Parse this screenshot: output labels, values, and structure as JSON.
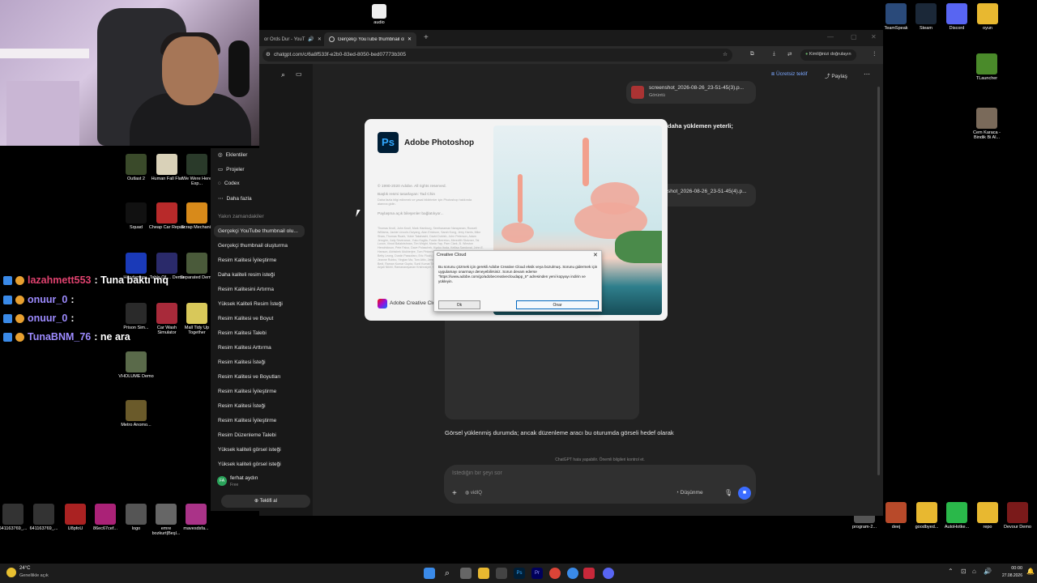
{
  "top_icon": {
    "label": "audio"
  },
  "browser": {
    "tabs": [
      {
        "label": "or Ords Dur - YouT"
      },
      {
        "label": "Gerçekçi YouTube thumbnail ol"
      }
    ],
    "url": "chatgpt.com/c/6a8f533f-e2b0-83ed-8050-bed07773b305",
    "verify_label": "Kimliğinizi doğrulayın"
  },
  "chatgpt": {
    "free_offer": "Ücretsiz teklif",
    "share": "Paylaş",
    "side_nav": [
      "Eklentiler",
      "Projeler",
      "Codex",
      "Daha fazla"
    ],
    "recent_title": "Yakın zamandakiler",
    "recent": [
      "Gerçekçi YouTube thumbnail olu...",
      "Gerçekçi thumbnail oluşturma",
      "Resim Kalitesi İyileştirme",
      "Daha kaliteli resim isteği",
      "Resim Kalitesini Artırma",
      "Yüksek Kaliteli Resim İsteği",
      "Resim Kalitesi ve Boyut",
      "Resim Kalitesi Talebi",
      "Resim Kalitesi Arttırma",
      "Resim Kalitesi İsteği",
      "Resim Kalitesi ve Boyutları",
      "Resim Kalitesi İyileştirme",
      "Resim Kalitesi İsteği",
      "Resim Kalitesi İyileştirme",
      "Resim Düzenleme Talebi",
      "Yüksek kaliteli görsel isteği",
      "Yüksek kaliteli görsel isteği"
    ],
    "user": {
      "name": "ferhat aydın",
      "plan": "Free",
      "initials": "FA"
    },
    "upgrade": "Teklifi al",
    "attachment1": {
      "name": "screenshot_2026-08-26_23-51-45(3).p...",
      "type": "Görüntü"
    },
    "attachment2": {
      "name": "shot_2026-08-26_23-51-45(4).p..."
    },
    "user_msg": "daha yüklemen yeterli;",
    "assistant_msg": "Görsel yüklenmiş durumda; ancak düzenleme aracı bu oturumda görseli hedef olarak",
    "disclaimer": "ChatGPT hata yapabilir. Önemli bilgileri kontrol et.",
    "composer_placeholder": "İstediğin bir şeyi sor",
    "composer_tool": "vidIQ",
    "think_label": "Düşünme"
  },
  "photoshop": {
    "app_name": "Adobe Photoshop",
    "logo_text": "Ps",
    "copyright": "© 1990-2020 Adobe. All rights reserved.",
    "artist": "Başlık resmi tasarlayan: Tad Chin",
    "legal": "Daha fazla bilgi edinmek ve yasal bildirimler için Photoshop hakkında alanına gidin.",
    "loading": "Paylaşma açık bileşenler bağlatılıyor...",
    "credits": "Thomas Knoll, John Knoll, Mark Hamburg, Seetharaman Narayanan, Russell Williams, Jackie Lincoln-Owyang, Alan Erickson, Sarah Kong, Jerry Harris, Mike Shaw, Thomas Ruark, Yukie Takahashi, David Dobish, John Peterson, Adam Jerugim, Judy Severance, Yuko Kagita, Foster Brereton, Meredith Stotzner, Tai Luxon, Vinod Balakrishnan, Tim Wright, Maria Yap, Pam Clark, B. Winston Hendrickson, Pete Falco, Dave Polaschek, Kyoko Itoda, Kellisa Sandoval, John E. Hanson, Abhishek Mukherjee, Tom Pinkerton, Michael Orts, Seth Shaw, Joel Baer, Betty Leong, Dustin Passofaro, Eric Floch, Ivy Mak, Blake Marlow, Michael Clifton, Jeanne Rubbo, Yinglan Ma, Tom Attix, Jenn Seelo, Ruchi Sood, Yilin Wang, Ajay Bedi, Raman Kumar Gupta, Sunil Kumar Tandon, Rick Mandia, Ashish Chandra, Anjali Nikhil, Ramanarayanan Krishnaiyer, Sohrab Amirghodsi, Louise Huang",
    "cc_footer": "Adobe Creative Cloud"
  },
  "creative_cloud_dialog": {
    "title": "Creative Cloud",
    "message": "Bu sorunu çözmek için gerekli Adobe Creative Cloud eksik veya bozulmuş. Sorunu gidermek için uygulamayı onarmayı deneyebilirsiniz. Sorun devam ederse \"https://www.adobe.com/go/adobecreativecloudapp_tr\" adresinden yeni kopyayı indirin ve yükleyin.",
    "button_left": "Ok",
    "button_right": "Onar"
  },
  "stream_chat": [
    {
      "user": "lazahmett553",
      "text": ": Tuna baktı mq",
      "color": "#e0426f"
    },
    {
      "user": "onuur_0",
      "text": ":",
      "color": "#9d8bff"
    },
    {
      "user": "onuur_0",
      "text": ":",
      "color": "#9d8bff"
    },
    {
      "user": "TunaBNM_76",
      "text": ": ne ara",
      "color": "#9d8bff"
    }
  ],
  "desktop_left": [
    {
      "label": "Outlast 2",
      "color": "#3a4a2a"
    },
    {
      "label": "Human Fall Flat",
      "color": "#d9d1b8"
    },
    {
      "label": "We Were Here Exp...",
      "color": "#2a3a2a"
    },
    {
      "label": "Squad",
      "color": "#111111"
    },
    {
      "label": "Cheap Car Repair",
      "color": "#b82a2a"
    },
    {
      "label": "Scrap Mechanic",
      "color": "#d88a1a"
    },
    {
      "label": "Handyman...",
      "color": "#1a3ab8"
    },
    {
      "label": "Table Of ... Demo",
      "color": "#2a2a6a"
    },
    {
      "label": "Separated Demo",
      "color": "#4a5a3a"
    },
    {
      "label": "Prison Sim...",
      "color": "#2a2a2a"
    },
    {
      "label": "Car Wash Simulator",
      "color": "#a82a3a"
    },
    {
      "label": "Mall Tidy Up Together",
      "color": "#d8c85a"
    },
    {
      "label": "VHOLUME Demo",
      "color": "#5a6a4a"
    },
    {
      "label": "Metro Anomo...",
      "color": "#6a5a2a"
    }
  ],
  "desktop_bottom": [
    {
      "label": "641163769_...",
      "color": "#333333"
    },
    {
      "label": "641163769_...",
      "color": "#333333"
    },
    {
      "label": "U8pfoU",
      "color": "#aa2222"
    },
    {
      "label": "86ec67cef...",
      "color": "#aa2277"
    },
    {
      "label": "logo",
      "color": "#555555"
    },
    {
      "label": "emre bozkurt|Beşl...",
      "color": "#666666"
    },
    {
      "label": "mavesdsfa...",
      "color": "#aa3388"
    }
  ],
  "desktop_right_top": [
    {
      "label": "TeamSpeak",
      "color": "#2a4a7a"
    },
    {
      "label": "Steam",
      "color": "#1b2838"
    },
    {
      "label": "Discord",
      "color": "#5865f2"
    },
    {
      "label": "oyun",
      "color": "#e8b830"
    }
  ],
  "desktop_right_mid": [
    {
      "label": "TLauncher",
      "color": "#4a8a2a"
    },
    {
      "label": "Cem Karaca - Bindik Bi Al...",
      "color": "#7a6a5a"
    }
  ],
  "desktop_right_bottom": [
    {
      "label": "program-2...",
      "color": "#555555"
    },
    {
      "label": "deej",
      "color": "#b84a2a"
    },
    {
      "label": "goodbyed...",
      "color": "#e8b830"
    },
    {
      "label": "AutoHotke...",
      "color": "#2ab84a"
    },
    {
      "label": "repo",
      "color": "#e8b830"
    },
    {
      "label": "Devour Demo",
      "color": "#7a1a1a"
    }
  ],
  "taskbar": {
    "weather_temp": "24°C",
    "weather_desc": "Genellikle açık",
    "time": "00:00",
    "date": "27.08.2026"
  }
}
